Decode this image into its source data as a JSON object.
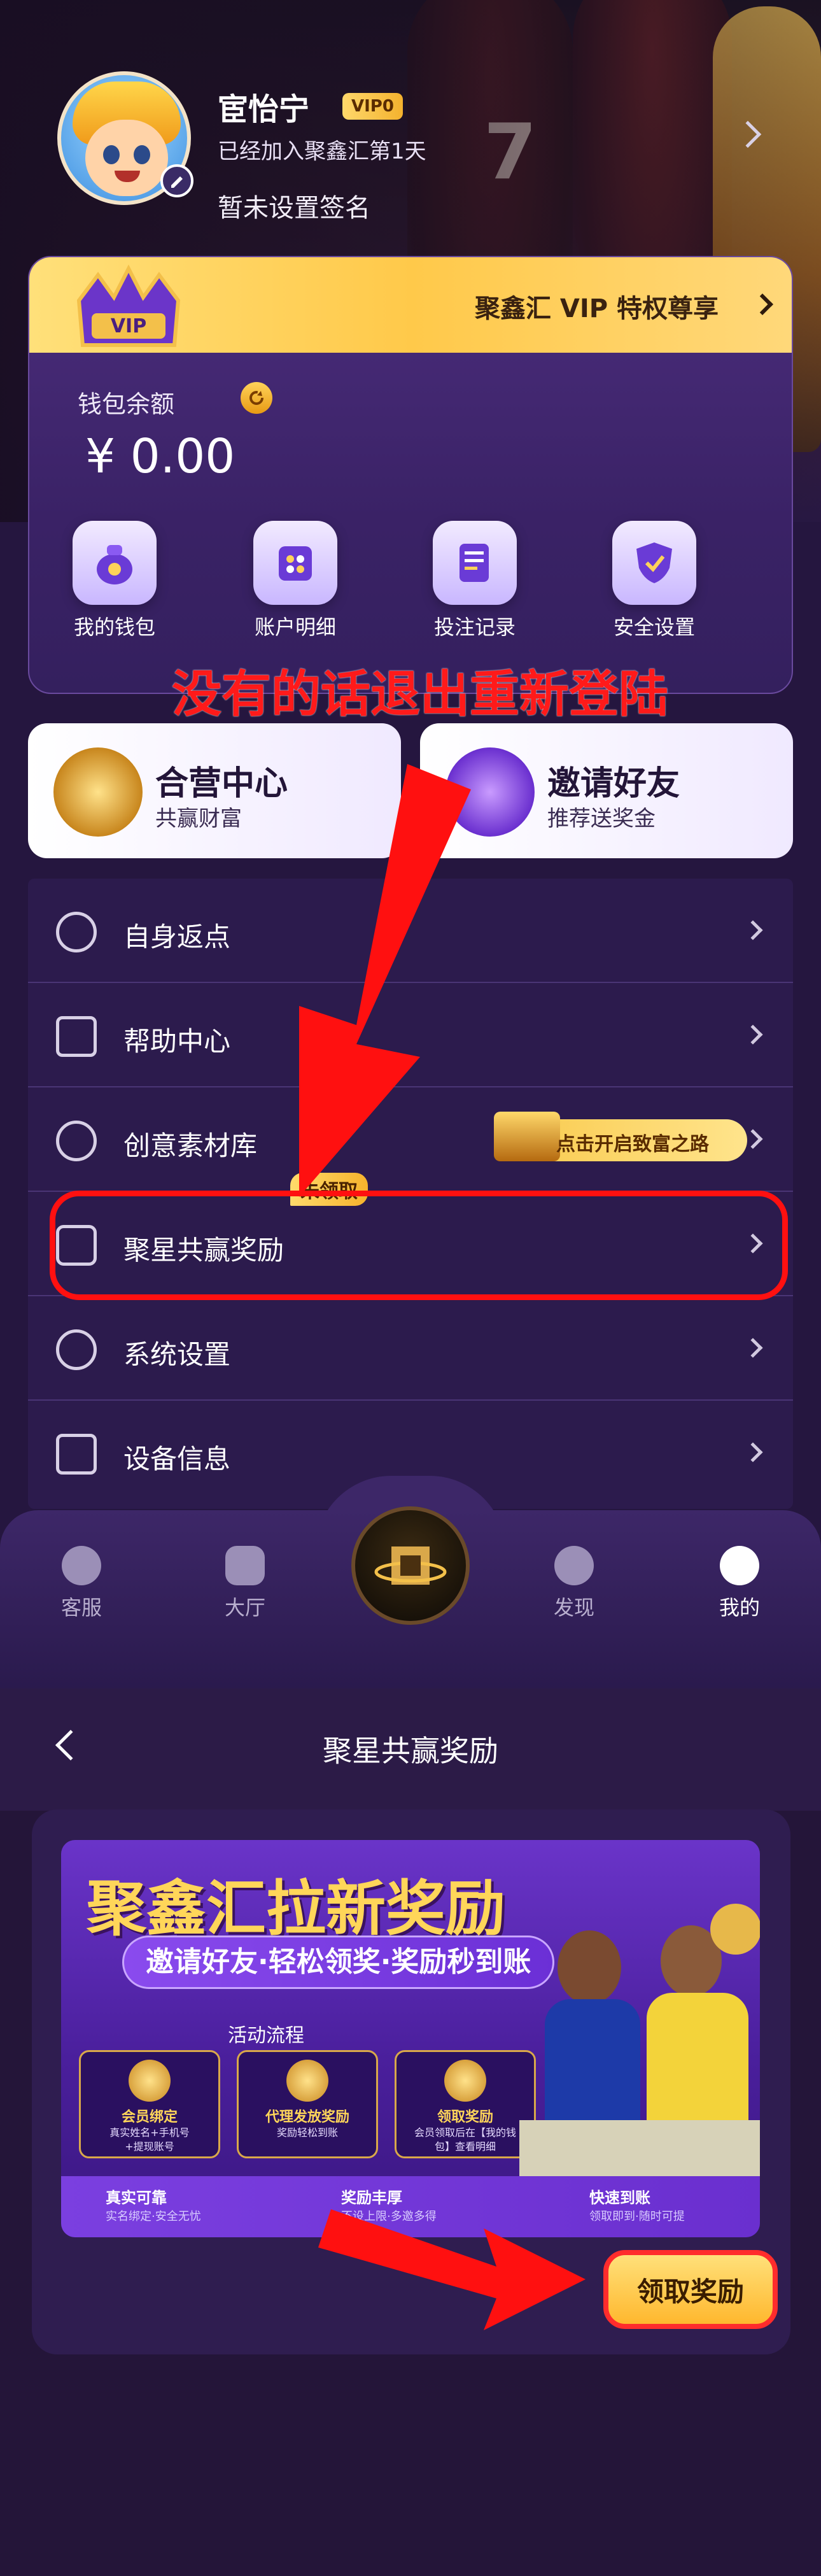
{
  "profile": {
    "username": "宦怡宁",
    "vip_level": "VIP0",
    "join_text": "已经加入聚鑫汇第1天",
    "signature": "暂未设置签名"
  },
  "vip_banner": {
    "title": "聚鑫汇 VIP 特权尊享"
  },
  "wallet": {
    "label": "钱包余额",
    "balance": "¥ 0.00",
    "actions": [
      {
        "label": "我的钱包",
        "icon": "money-bag-icon"
      },
      {
        "label": "账户明细",
        "icon": "ledger-icon"
      },
      {
        "label": "投注记录",
        "icon": "record-icon"
      },
      {
        "label": "安全设置",
        "icon": "shield-icon"
      }
    ]
  },
  "annotation": {
    "note": "没有的话退出重新登陆"
  },
  "promos": [
    {
      "title": "合营中心",
      "subtitle": "共赢财富"
    },
    {
      "title": "邀请好友",
      "subtitle": "推荐送奖金"
    }
  ],
  "menu": {
    "items": [
      {
        "label": "自身返点",
        "icon": "percent-icon"
      },
      {
        "label": "帮助中心",
        "icon": "question-icon"
      },
      {
        "label": "创意素材库",
        "icon": "play-icon"
      },
      {
        "label": "聚星共赢奖励",
        "icon": "handshake-icon"
      },
      {
        "label": "系统设置",
        "icon": "gear-icon"
      },
      {
        "label": "设备信息",
        "icon": "device-icon"
      }
    ],
    "creative_button": "点击开启致富之路",
    "unclaimed_badge": "未领取"
  },
  "bottom_nav": [
    {
      "label": "客服",
      "icon": "chat-icon"
    },
    {
      "label": "大厅",
      "icon": "lobby-icon"
    },
    {
      "label": "",
      "icon": "brand-logo-icon"
    },
    {
      "label": "发现",
      "icon": "compass-icon"
    },
    {
      "label": "我的",
      "icon": "user-icon"
    }
  ],
  "reward_page": {
    "title": "聚星共赢奖励",
    "banner": {
      "title": "聚鑫汇拉新奖励",
      "subtitle": "邀请好友·轻松领奖·奖励秒到账",
      "flow_label": "活动流程",
      "steps": [
        {
          "title": "会员绑定",
          "desc1": "真实姓名+手机号",
          "desc2": "+提现账号"
        },
        {
          "title": "代理发放奖励",
          "desc1": "奖励轻松到账",
          "desc2": ""
        },
        {
          "title": "领取奖励",
          "desc1": "会员领取后在【我的钱",
          "desc2": "包】查看明细"
        }
      ],
      "footer": [
        {
          "title": "真实可靠",
          "desc": "实名绑定·安全无忧"
        },
        {
          "title": "奖励丰厚",
          "desc": "不设上限·多邀多得"
        },
        {
          "title": "快速到账",
          "desc": "领取即到·随时可提"
        }
      ]
    },
    "claim_button": "领取奖励"
  },
  "colors": {
    "accent_gold": "#ffc94a",
    "bg_purple": "#25163f",
    "annotation_red": "#ff1010"
  }
}
